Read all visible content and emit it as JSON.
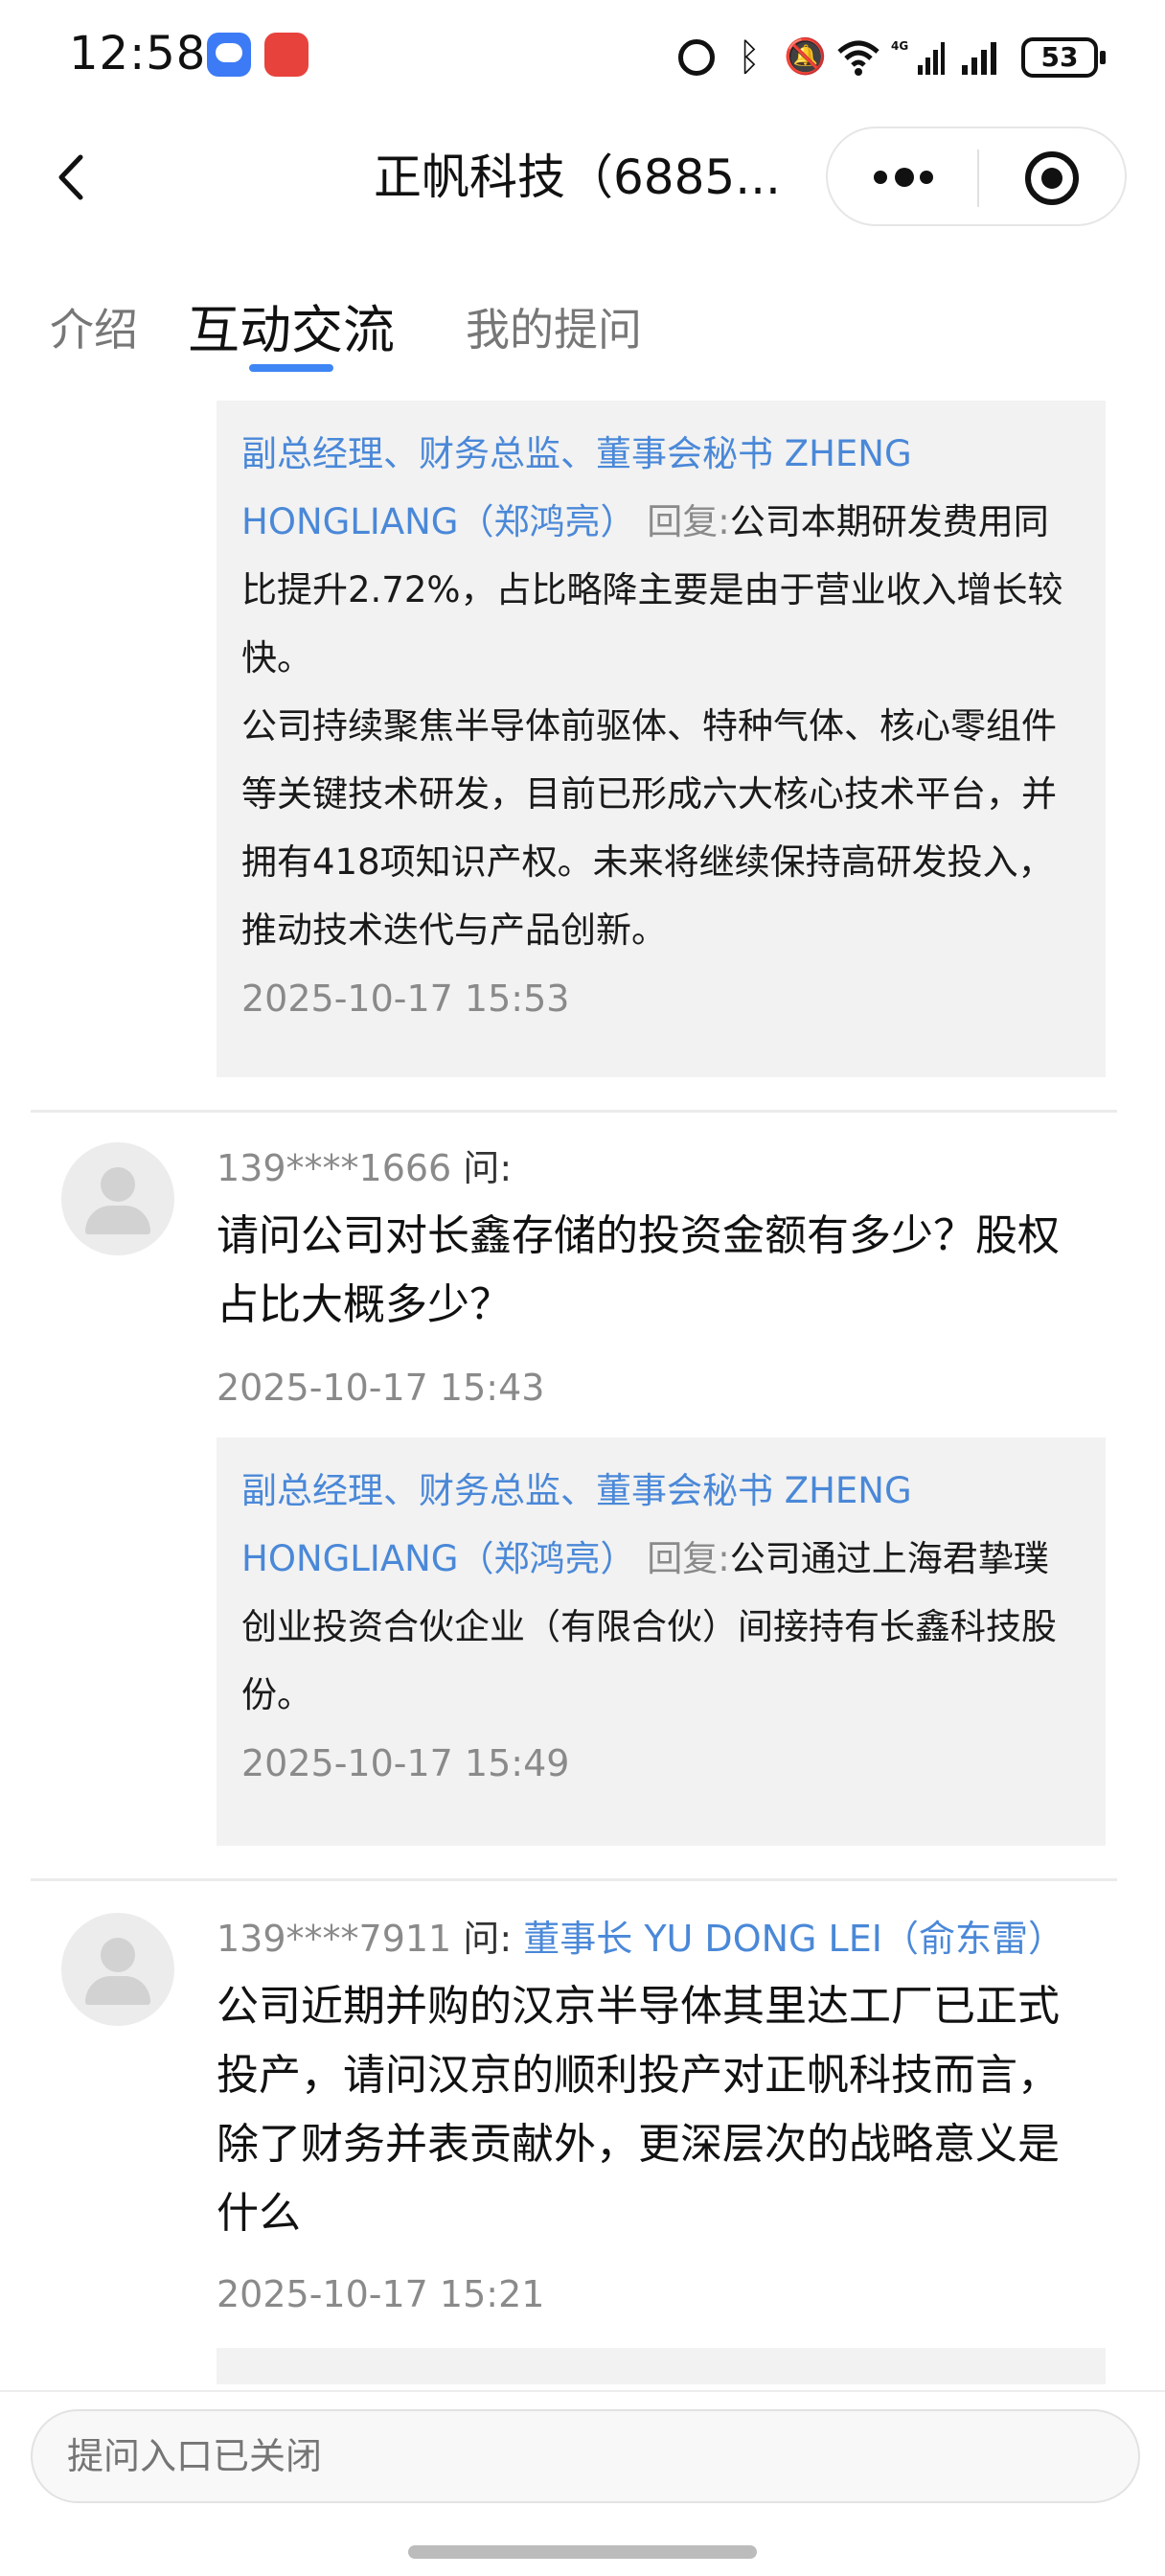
{
  "status_bar": {
    "time": "12:58",
    "app_gallery_label": "App Gallery",
    "network": "4G",
    "battery": "53"
  },
  "nav": {
    "title": "正帆科技（6885..."
  },
  "tabs": [
    {
      "label": "介绍"
    },
    {
      "label": "互动交流"
    },
    {
      "label": "我的提问"
    }
  ],
  "threads": [
    {
      "reply": {
        "author": "副总经理、财务总监、董事会秘书 ZHENG HONGLIANG（郑鸿亮）",
        "label": "回复:",
        "text": "公司本期研发费用同比提升2.72%，占比略降主要是由于营业收入增长较快。\n公司持续聚焦半导体前驱体、特种气体、核心零组件等关键技术研发，目前已形成六大核心技术平台，并拥有418项知识产权。未来将继续保持高研发投入，推动技术迭代与产品创新。",
        "time": "2025-10-17 15:53"
      }
    },
    {
      "question": {
        "user": "139****1666",
        "label": "问:",
        "target": "",
        "text": "请问公司对长鑫存储的投资金额有多少？股权占比大概多少？",
        "time": "2025-10-17 15:43"
      },
      "reply": {
        "author": "副总经理、财务总监、董事会秘书 ZHENG HONGLIANG（郑鸿亮）",
        "label": "回复:",
        "text": "公司通过上海君挚璞创业投资合伙企业（有限合伙）间接持有长鑫科技股份。",
        "time": "2025-10-17 15:49"
      }
    },
    {
      "question": {
        "user": "139****7911",
        "label": "问:",
        "target": "董事长 YU DONG LEI（俞东雷）",
        "text": "公司近期并购的汉京半导体其里达工厂已正式投产，请问汉京的顺利投产对正帆科技而言，除了财务并表贡献外，更深层次的战略意义是什么",
        "time": "2025-10-17 15:21"
      }
    }
  ],
  "bottom": {
    "input_placeholder": "提问入口已关闭"
  }
}
